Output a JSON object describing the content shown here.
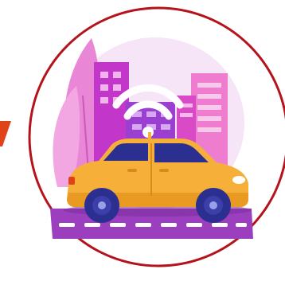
{
  "image": {
    "subject": "connected-car-icon",
    "colors": {
      "frame_ring": "#b5121b",
      "background": "#ffffff",
      "circle_fill": "#ffffff",
      "glow": "#f3d9f5",
      "building_magenta": "#c237c9",
      "building_violet": "#9a3fd0",
      "building_pink": "#ee7ccf",
      "leaf": "#e987d6",
      "road": "#9b3fbf",
      "road_dash": "#ffffff",
      "car_body": "#f6b03a",
      "car_window": "#2b2f8f",
      "wheel": "#3b3faa",
      "wifi": "#ffffff",
      "accent_mark": "#e0421a"
    },
    "icons": [
      "wifi-icon",
      "car-icon",
      "buildings-icon",
      "leaf-icon",
      "road-icon"
    ]
  }
}
